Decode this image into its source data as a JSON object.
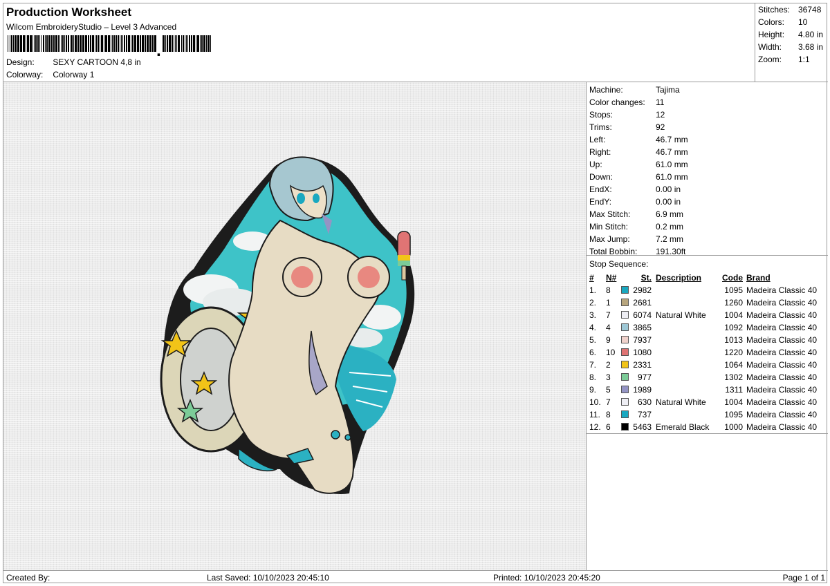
{
  "header": {
    "title": "Production Worksheet",
    "subtitle": "Wilcom EmbroideryStudio – Level 3 Advanced",
    "design_label": "Design:",
    "design_value": "SEXY CARTOON 4,8 in",
    "colorway_label": "Colorway:",
    "colorway_value": "Colorway 1"
  },
  "stats": [
    {
      "label": "Stitches:",
      "value": "36748"
    },
    {
      "label": "Colors:",
      "value": "10"
    },
    {
      "label": "Height:",
      "value": "4.80 in"
    },
    {
      "label": "Width:",
      "value": "3.68 in"
    },
    {
      "label": "Zoom:",
      "value": "1:1"
    }
  ],
  "machine_info": [
    {
      "label": "Machine:",
      "value": "Tajima"
    },
    {
      "label": "Color changes:",
      "value": "11"
    },
    {
      "label": "Stops:",
      "value": "12"
    },
    {
      "label": "Trims:",
      "value": "92"
    },
    {
      "label": "Left:",
      "value": "46.7 mm"
    },
    {
      "label": "Right:",
      "value": "46.7 mm"
    },
    {
      "label": "Up:",
      "value": "61.0 mm"
    },
    {
      "label": "Down:",
      "value": "61.0 mm"
    },
    {
      "label": "EndX:",
      "value": "0.00 in"
    },
    {
      "label": "EndY:",
      "value": "0.00 in"
    },
    {
      "label": "Max Stitch:",
      "value": "6.9 mm"
    },
    {
      "label": "Min Stitch:",
      "value": "0.2 mm"
    },
    {
      "label": "Max Jump:",
      "value": "7.2 mm"
    },
    {
      "label": "Total Bobbin:",
      "value": "191.30ft"
    }
  ],
  "stop_sequence": {
    "label": "Stop Sequence:",
    "headers": {
      "num": "#",
      "n": "N#",
      "st": "St.",
      "desc": "Description",
      "code": "Code",
      "brand": "Brand"
    },
    "rows": [
      {
        "num": "1.",
        "n": "8",
        "color": "#1aa8c0",
        "st": "2982",
        "desc": "",
        "code": "1095",
        "brand": "Madeira Classic 40"
      },
      {
        "num": "2.",
        "n": "1",
        "color": "#b8a67e",
        "st": "2681",
        "desc": "",
        "code": "1260",
        "brand": "Madeira Classic 40"
      },
      {
        "num": "3.",
        "n": "7",
        "color": "#eeeef4",
        "st": "6074",
        "desc": "Natural White",
        "code": "1004",
        "brand": "Madeira Classic 40"
      },
      {
        "num": "4.",
        "n": "4",
        "color": "#9ec8d6",
        "st": "3865",
        "desc": "",
        "code": "1092",
        "brand": "Madeira Classic 40"
      },
      {
        "num": "5.",
        "n": "9",
        "color": "#f0d2cc",
        "st": "7937",
        "desc": "",
        "code": "1013",
        "brand": "Madeira Classic 40"
      },
      {
        "num": "6.",
        "n": "10",
        "color": "#e07474",
        "st": "1080",
        "desc": "",
        "code": "1220",
        "brand": "Madeira Classic 40"
      },
      {
        "num": "7.",
        "n": "2",
        "color": "#f2c418",
        "st": "2331",
        "desc": "",
        "code": "1064",
        "brand": "Madeira Classic 40"
      },
      {
        "num": "8.",
        "n": "3",
        "color": "#7ccc98",
        "st": "977",
        "desc": "",
        "code": "1302",
        "brand": "Madeira Classic 40"
      },
      {
        "num": "9.",
        "n": "5",
        "color": "#9494c4",
        "st": "1989",
        "desc": "",
        "code": "1311",
        "brand": "Madeira Classic 40"
      },
      {
        "num": "10.",
        "n": "7",
        "color": "#eeeef4",
        "st": "630",
        "desc": "Natural White",
        "code": "1004",
        "brand": "Madeira Classic 40"
      },
      {
        "num": "11.",
        "n": "8",
        "color": "#1aa8c0",
        "st": "737",
        "desc": "",
        "code": "1095",
        "brand": "Madeira Classic 40"
      },
      {
        "num": "12.",
        "n": "6",
        "color": "#000000",
        "st": "5463",
        "desc": "Emerald Black",
        "code": "1000",
        "brand": "Madeira Classic 40"
      }
    ]
  },
  "footer": {
    "created_by": "Created By:",
    "last_saved": "Last Saved: 10/10/2023 20:45:10",
    "printed": "Printed: 10/10/2023 20:45:20",
    "page": "Page 1 of 1"
  }
}
